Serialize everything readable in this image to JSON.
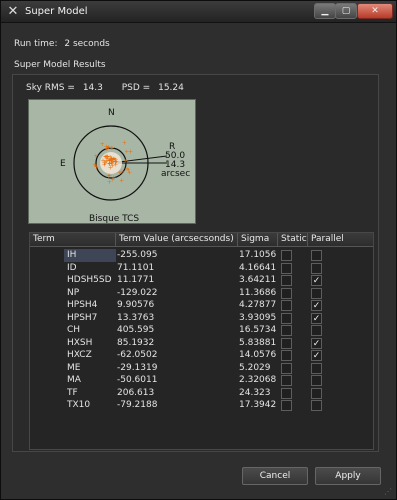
{
  "window": {
    "title": "Super Model"
  },
  "runtime": {
    "label": "Run time:",
    "value": "2 seconds"
  },
  "section_title": "Super Model Results",
  "sky": {
    "rms_label": "Sky RMS =",
    "rms_value": "14.3",
    "psd_label": "PSD =",
    "psd_value": "15.24"
  },
  "plot": {
    "north_label": "N",
    "east_label": "E",
    "r_label": "R",
    "r_outer": "50.0",
    "r_inner": "14.3",
    "r_unit": "arcsec",
    "caption": "Bisque TCS"
  },
  "table": {
    "headers": [
      "Term",
      "Term Value (arcsecsonds)",
      "Sigma",
      "Static",
      "Parallel"
    ],
    "rows": [
      {
        "term": "IH",
        "value": "-255.095",
        "sigma": "17.1056",
        "static": false,
        "parallel": false
      },
      {
        "term": "ID",
        "value": "71.1101",
        "sigma": "4.16641",
        "static": false,
        "parallel": false
      },
      {
        "term": "HDSH5SD",
        "value": "11.1771",
        "sigma": "3.64211",
        "static": false,
        "parallel": true
      },
      {
        "term": "NP",
        "value": "-129.022",
        "sigma": "11.3686",
        "static": false,
        "parallel": false
      },
      {
        "term": "HPSH4",
        "value": "9.90576",
        "sigma": "4.27877",
        "static": false,
        "parallel": true
      },
      {
        "term": "HPSH7",
        "value": "13.3763",
        "sigma": "3.93095",
        "static": false,
        "parallel": true
      },
      {
        "term": "CH",
        "value": "405.595",
        "sigma": "16.5734",
        "static": false,
        "parallel": false
      },
      {
        "term": "HXSH",
        "value": "85.1932",
        "sigma": "5.83881",
        "static": false,
        "parallel": true
      },
      {
        "term": "HXCZ",
        "value": "-62.0502",
        "sigma": "14.0576",
        "static": false,
        "parallel": true
      },
      {
        "term": "ME",
        "value": "-29.1319",
        "sigma": "5.2029",
        "static": false,
        "parallel": false
      },
      {
        "term": "MA",
        "value": "-50.6011",
        "sigma": "2.32068",
        "static": false,
        "parallel": false
      },
      {
        "term": "TF",
        "value": "206.613",
        "sigma": "24.323",
        "static": false,
        "parallel": false
      },
      {
        "term": "TX10",
        "value": "-79.2188",
        "sigma": "17.3942",
        "static": false,
        "parallel": false
      }
    ]
  },
  "buttons": {
    "cancel": "Cancel",
    "apply": "Apply"
  },
  "tick_glyph": "✓"
}
